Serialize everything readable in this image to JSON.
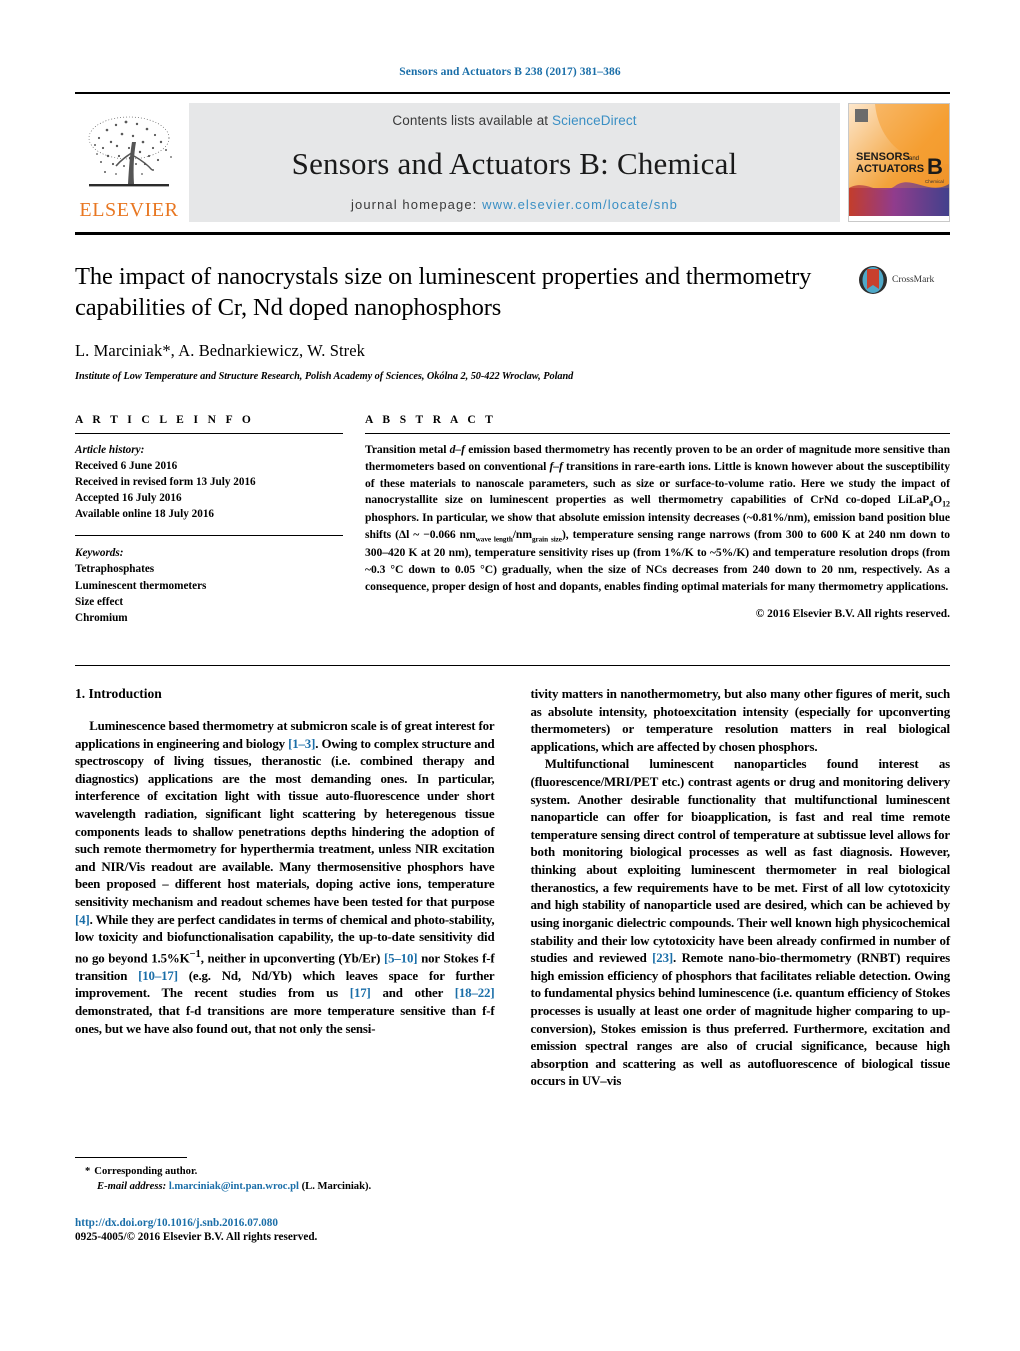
{
  "running_head": "Sensors and Actuators B 238 (2017) 381–386",
  "masthead": {
    "publisher_name": "ELSEVIER",
    "contents_prefix": "Contents lists available at ",
    "contents_link": "ScienceDirect",
    "journal_title": "Sensors and Actuators B: Chemical",
    "homepage_prefix": "journal homepage: ",
    "homepage_url": "www.elsevier.com/locate/snb",
    "cover": {
      "line1": "SENSORS",
      "line1_small": "and",
      "line2": "ACTUATORS",
      "letter": "B",
      "letter_sub": "Chemical"
    }
  },
  "article": {
    "title": "The impact of nanocrystals size on luminescent properties and thermometry capabilities of Cr, Nd doped nanophosphors",
    "authors": "L. Marciniak*, A. Bednarkiewicz, W. Strek",
    "affiliation": "Institute of Low Temperature and Structure Research, Polish Academy of Sciences, Okólna 2, 50-422 Wroclaw, Poland",
    "crossmark_label": "CrossMark"
  },
  "info": {
    "heading": "A R T I C L E   I N F O",
    "history_label": "Article history:",
    "history": [
      "Received 6 June 2016",
      "Received in revised form 13 July 2016",
      "Accepted 16 July 2016",
      "Available online 18 July 2016"
    ],
    "keywords_label": "Keywords:",
    "keywords": [
      "Tetraphosphates",
      "Luminescent thermometers",
      "Size effect",
      "Chromium"
    ]
  },
  "abstract": {
    "heading": "A B S T R A C T",
    "para_1": "Transition metal ",
    "em_1": "d–f",
    "para_2": " emission based thermometry has recently proven to be an order of magnitude more sensitive than thermometers based on conventional ",
    "em_2": "f–f",
    "para_3": " transitions in rare-earth ions. Little is known however about the susceptibility of these materials to nanoscale parameters, such as size or surface-to-volume ratio. Here we study the impact of nanocrystallite size on luminescent properties as well thermometry capabilities of CrNd co-doped LiLaP",
    "sub_1": "4",
    "para_4": "O",
    "sub_2": "12",
    "para_5": " phosphors. In particular, we show that absolute emission intensity decreases (~0.81%/nm), emission band position blue shifts (Δl ~ −0.066 nm",
    "sub_3": "wave length",
    "para_6": "/nm",
    "sub_4": "grain size",
    "para_7": "), temperature sensing range narrows (from 300 to 600 K at 240 nm down to 300–420 K at 20 nm), temperature sensitivity rises up (from 1%/K to ~5%/K) and temperature resolution drops (from ~0.3 °C down to 0.05 °C) gradually, when the size of NCs decreases from 240 down to 20 nm, respectively. As a consequence, proper design of host and dopants, enables finding optimal materials for many thermometry applications.",
    "copyright": "© 2016 Elsevier B.V. All rights reserved."
  },
  "body": {
    "section_number_title": "1.  Introduction",
    "left_para_1_a": "Luminescence based thermometry at submicron scale is of great interest for applications in engineering and biology ",
    "left_ref_1": "[1–3]",
    "left_para_1_b": ". Owing to complex structure and spectroscopy of living tissues, theranostic (i.e. combined therapy and diagnostics) applications are the most demanding ones. In particular, interference of excitation light with tissue auto-fluorescence under short wavelength radiation, significant light scattering by heteregenous tissue components leads to shallow penetrations depths hindering the adoption of such remote thermometry for hyperthermia treatment, unless NIR excitation and NIR/Vis readout are available. Many thermosensitive phosphors have been proposed – different host materials, doping active ions, temperature sensitivity mechanism and readout schemes have been tested for that purpose ",
    "left_ref_2": "[4]",
    "left_para_1_c": ". While they are perfect candidates in terms of chemical and photo-stability, low toxicity and biofunctionalisation capability, the up-to-date sensitivity did no go beyond 1.5%K",
    "left_sup_1": "−1",
    "left_para_1_d": ", neither in upconverting (Yb/Er) ",
    "left_ref_3": "[5–10]",
    "left_para_1_e": " nor Stokes f-f transition ",
    "left_ref_4": "[10–17]",
    "left_para_1_f": " (e.g. Nd, Nd/Yb) which leaves space for further improvement. The recent studies from us ",
    "left_ref_5": "[17]",
    "left_para_1_g": " and other ",
    "left_ref_6": "[18–22]",
    "left_para_1_h": " demonstrated, that f-d transitions are more temperature sensitive than f-f ones, but we have also found out, that not only the sensi-",
    "right_para_1": "tivity matters in nanothermometry, but also many other figures of merit, such as absolute intensity, photoexcitation intensity (especially for upconverting thermometers) or temperature resolution matters in real biological applications, which are affected by chosen phosphors.",
    "right_para_2_a": "Multifunctional luminescent nanoparticles found interest as (fluorescence/MRI/PET etc.) contrast agents or drug and monitoring delivery system. Another desirable functionality that multifunctional luminescent nanoparticle can offer for bioapplication, is fast and real time remote temperature sensing direct control of temperature at subtissue level allows for both monitoring biological processes as well as fast diagnosis. However, thinking about exploiting luminescent thermometer in real biological theranostics, a few requirements have to be met. First of all low cytotoxicity and high stability of nanoparticle used are desired, which can be achieved by using inorganic dielectric compounds. Their well known high physicochemical stability and their low cytotoxicity have been already confirmed in number of studies and reviewed ",
    "right_ref_1": "[23]",
    "right_para_2_b": ". Remote nano-bio-thermometry (RNBT) requires high emission efficiency of phosphors that facilitates reliable detection. Owing to fundamental physics behind luminescence (i.e. quantum efficiency of Stokes processes is usually at least one order of magnitude higher comparing to up-conversion), Stokes emission is thus preferred. Furthermore, excitation and emission spectral ranges are also of crucial significance, because high absorption and scattering as well as autofluorescence of biological tissue occurs in UV–vis"
  },
  "footnotes": {
    "corresponding_star": "*",
    "corresponding_text": "Corresponding author.",
    "email_label": "E-mail address:",
    "email": "l.marciniak@int.pan.wroc.pl",
    "email_suffix": "(L. Marciniak).",
    "doi": "http://dx.doi.org/10.1016/j.snb.2016.07.080",
    "issn_line": "0925-4005/© 2016 Elsevier B.V. All rights reserved."
  },
  "colors": {
    "link_blue": "#1a6ea8",
    "sciencedirect_blue": "#3a8fc4",
    "elsevier_orange": "#E87722",
    "band_gray": "#e6e7e8"
  }
}
